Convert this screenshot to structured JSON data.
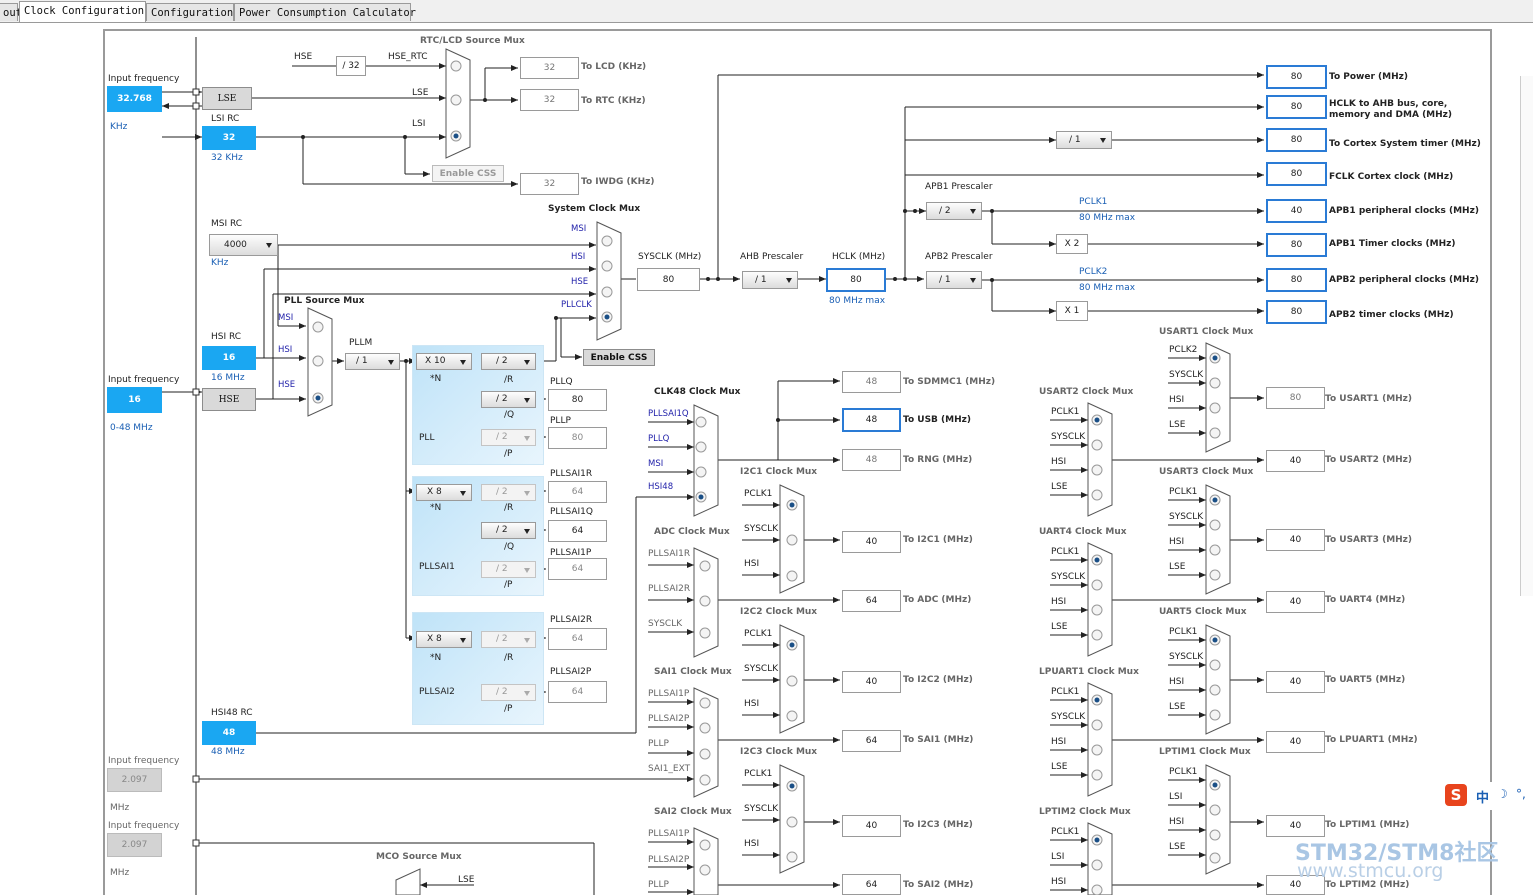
{
  "tabs": [
    {
      "label": "out"
    },
    {
      "label": "Clock Configuration"
    },
    {
      "label": "Configuration"
    },
    {
      "label": "Power Consumption Calculator"
    }
  ],
  "left": {
    "input_freq_label": "Input frequency",
    "lse_input": "32.768",
    "lse_unit": "KHz",
    "lse_label": "LSE",
    "lsi_label": "LSI RC",
    "lsi_value": "32",
    "lsi_unit": "32 KHz",
    "msi_label": "MSI RC",
    "msi_value": "4000",
    "msi_unit": "KHz",
    "hsi_label": "HSI RC",
    "hsi_value": "16",
    "hsi_unit": "16 MHz",
    "hse_freq_label": "Input frequency",
    "hse_input": "16",
    "hse_label": "HSE",
    "hse_range": "0-48 MHz",
    "hsi48_label": "HSI48 RC",
    "hsi48_value": "48",
    "hsi48_unit": "48 MHz",
    "sai1_freq_label": "Input frequency",
    "sai1_freq_value": "2.097",
    "sai1_unit": "MHz",
    "sai2_freq_label": "Input frequency",
    "sai2_freq_value": "2.097",
    "sai2_unit": "MHz"
  },
  "rtc": {
    "title": "RTC/LCD Source Mux",
    "hse": "HSE",
    "div32": "/ 32",
    "hse_rtc": "HSE_RTC",
    "lse": "LSE",
    "lsi": "LSI",
    "enable_css": "Enable CSS",
    "lcd_value": "32",
    "lcd_label": "To LCD (KHz)",
    "rtc_value": "32",
    "rtc_label": "To RTC (KHz)",
    "iwdg_value": "32",
    "iwdg_label": "To IWDG (KHz)"
  },
  "sysmux": {
    "title": "System Clock Mux",
    "msi": "MSI",
    "hsi": "HSI",
    "hse": "HSE",
    "pllclk": "PLLCLK",
    "enable_css": "Enable CSS",
    "sysclk_label": "SYSCLK (MHz)",
    "sysclk_value": "80",
    "ahb_label": "AHB Prescaler",
    "ahb_value": "/ 1",
    "hclk_label": "HCLK (MHz)",
    "hclk_value": "80",
    "hclk_max": "80 MHz max"
  },
  "pll": {
    "src_title": "PLL Source Mux",
    "msi": "MSI",
    "hsi": "HSI",
    "hse": "HSE",
    "pllm_label": "PLLM",
    "pllm_value": "/ 1",
    "n_value": "X 10",
    "n_label": "*N",
    "r_value": "/ 2",
    "r_label": "/R",
    "q_value": "/ 2",
    "q_label": "/Q",
    "p_value": "/ 2",
    "p_label": "/P",
    "name": "PLL",
    "pllq_label": "PLLQ",
    "pllq_value": "80",
    "pllp_label": "PLLP",
    "pllp_value": "80"
  },
  "pllsai1": {
    "n_value": "X 8",
    "n_label": "*N",
    "r_value": "/ 2",
    "r_label": "/R",
    "q_value": "/ 2",
    "q_label": "/Q",
    "p_value": "/ 2",
    "p_label": "/P",
    "name": "PLLSAI1",
    "r_out_label": "PLLSAI1R",
    "r_out": "64",
    "q_out_label": "PLLSAI1Q",
    "q_out": "64",
    "p_out_label": "PLLSAI1P",
    "p_out": "64"
  },
  "pllsai2": {
    "n_value": "X 8",
    "n_label": "*N",
    "r_value": "/ 2",
    "r_label": "/R",
    "p_value": "/ 2",
    "p_label": "/P",
    "name": "PLLSAI2",
    "r_out_label": "PLLSAI2R",
    "r_out": "64",
    "p_out_label": "PLLSAI2P",
    "p_out": "64"
  },
  "bus": {
    "power_value": "80",
    "power_label": "To Power (MHz)",
    "hclk_ahb_value": "80",
    "hclk_ahb_label1": "HCLK to AHB bus, core,",
    "hclk_ahb_label2": "memory and DMA (MHz)",
    "cortex_div": "/ 1",
    "cortex_value": "80",
    "cortex_label": "To Cortex System timer (MHz)",
    "fclk_value": "80",
    "fclk_label": "FCLK Cortex clock (MHz)",
    "apb1_label": "APB1 Prescaler",
    "apb1_div": "/ 2",
    "pclk1": "PCLK1",
    "pclk1_max": "80 MHz max",
    "apb1_periph_value": "40",
    "apb1_periph_label": "APB1 peripheral clocks (MHz)",
    "apb1_x": "X 2",
    "apb1_timer_value": "80",
    "apb1_timer_label": "APB1 Timer clocks (MHz)",
    "apb2_label": "APB2 Prescaler",
    "apb2_div": "/ 1",
    "pclk2": "PCLK2",
    "pclk2_max": "80 MHz max",
    "apb2_periph_value": "80",
    "apb2_periph_label": "APB2 peripheral clocks (MHz)",
    "apb2_x": "X 1",
    "apb2_timer_value": "80",
    "apb2_timer_label": "APB2 timer clocks (MHz)"
  },
  "clk48": {
    "title": "CLK48 Clock Mux",
    "pllsai1q": "PLLSAI1Q",
    "pllq": "PLLQ",
    "msi": "MSI",
    "hsi48": "HSI48",
    "sdmmc_value": "48",
    "sdmmc_label": "To SDMMC1 (MHz)",
    "usb_value": "48",
    "usb_label": "To USB (MHz)",
    "rng_value": "48",
    "rng_label": "To RNG (MHz)"
  },
  "adc": {
    "title": "ADC Clock Mux",
    "in1": "PLLSAI1R",
    "in2": "PLLSAI2R",
    "in3": "SYSCLK",
    "value": "64",
    "label": "To ADC (MHz)"
  },
  "sai1": {
    "title": "SAI1 Clock Mux",
    "in1": "PLLSAI1P",
    "in2": "PLLSAI2P",
    "in3": "PLLP",
    "in4": "SAI1_EXT",
    "value": "64",
    "label": "To SAI1 (MHz)"
  },
  "sai2": {
    "title": "SAI2 Clock Mux",
    "in1": "PLLSAI1P",
    "in2": "PLLSAI2P",
    "in3": "PLLP",
    "value": "64",
    "label": "To SAI2 (MHz)"
  },
  "mco": {
    "title": "MCO Source Mux",
    "lse": "LSE"
  },
  "i2c1": {
    "title": "I2C1 Clock Mux",
    "in1": "PCLK1",
    "in2": "SYSCLK",
    "in3": "HSI",
    "value": "40",
    "label": "To I2C1 (MHz)"
  },
  "i2c2": {
    "title": "I2C2 Clock Mux",
    "in1": "PCLK1",
    "in2": "SYSCLK",
    "in3": "HSI",
    "value": "40",
    "label": "To I2C2 (MHz)"
  },
  "i2c3": {
    "title": "I2C3 Clock Mux",
    "in1": "PCLK1",
    "in2": "SYSCLK",
    "in3": "HSI",
    "value": "40",
    "label": "To I2C3 (MHz)"
  },
  "usart1": {
    "title": "USART1 Clock Mux",
    "in1": "PCLK2",
    "in2": "SYSCLK",
    "in3": "HSI",
    "in4": "LSE",
    "value": "80",
    "label": "To USART1 (MHz)"
  },
  "usart2": {
    "title": "USART2 Clock Mux",
    "in1": "PCLK1",
    "in2": "SYSCLK",
    "in3": "HSI",
    "in4": "LSE",
    "value": "40",
    "label": "To USART2 (MHz)"
  },
  "usart3": {
    "title": "USART3 Clock Mux",
    "in1": "PCLK1",
    "in2": "SYSCLK",
    "in3": "HSI",
    "in4": "LSE",
    "value": "40",
    "label": "To USART3 (MHz)"
  },
  "uart4": {
    "title": "UART4 Clock Mux",
    "in1": "PCLK1",
    "in2": "SYSCLK",
    "in3": "HSI",
    "in4": "LSE",
    "value": "40",
    "label": "To UART4 (MHz)"
  },
  "uart5": {
    "title": "UART5 Clock Mux",
    "in1": "PCLK1",
    "in2": "SYSCLK",
    "in3": "HSI",
    "in4": "LSE",
    "value": "40",
    "label": "To UART5 (MHz)"
  },
  "lpuart1": {
    "title": "LPUART1 Clock Mux",
    "in1": "PCLK1",
    "in2": "SYSCLK",
    "in3": "HSI",
    "in4": "LSE",
    "value": "40",
    "label": "To LPUART1 (MHz)"
  },
  "lptim1": {
    "title": "LPTIM1 Clock Mux",
    "in1": "PCLK1",
    "in2": "LSI",
    "in3": "HSI",
    "in4": "LSE",
    "value": "40",
    "label": "To LPTIM1 (MHz)"
  },
  "lptim2": {
    "title": "LPTIM2 Clock Mux",
    "in1": "PCLK1",
    "in2": "LSI",
    "in3": "HSI",
    "value": "40",
    "label": "To LPTIM2 (MHz)"
  },
  "watermark": {
    "line1": "STM32/STM8社区",
    "line2": "www.stmcu.org"
  },
  "ime": {
    "label": "中"
  },
  "colors": {
    "accent": "#1aa7f2",
    "output_border": "#2a7bd5",
    "line": "#222222"
  }
}
